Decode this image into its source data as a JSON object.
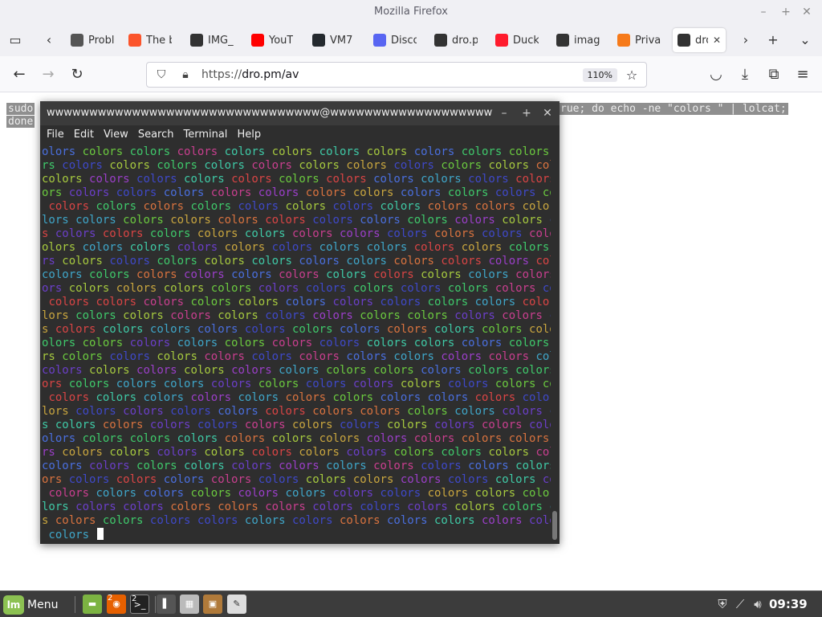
{
  "window": {
    "title": "Mozilla Firefox"
  },
  "tabs": [
    {
      "label": "Probl",
      "icon": "info-icon",
      "color": "#555555"
    },
    {
      "label": "The b",
      "icon": "brave-lion-icon",
      "color": "#fb542b"
    },
    {
      "label": "IMG_",
      "icon": "terminal-favicon",
      "color": "#333333"
    },
    {
      "label": "YouT",
      "icon": "youtube-icon",
      "color": "#ff0000"
    },
    {
      "label": "VM7",
      "icon": "github-icon",
      "color": "#24292e"
    },
    {
      "label": "Disco",
      "icon": "discord-icon",
      "color": "#5865f2"
    },
    {
      "label": "dro.p",
      "icon": "terminal-favicon",
      "color": "#333333"
    },
    {
      "label": "Duck",
      "icon": "opera-icon",
      "color": "#ff1b2d"
    },
    {
      "label": "imag",
      "icon": "terminal-favicon",
      "color": "#333333"
    },
    {
      "label": "Priva",
      "icon": "privacy-icon",
      "color": "#f67a1a"
    },
    {
      "label": "dro",
      "icon": "terminal-favicon",
      "color": "#333333",
      "active": true
    }
  ],
  "navbar": {
    "url_scheme": "https://",
    "url_rest": "dro.pm/av",
    "zoom": "110%"
  },
  "page": {
    "cmd_line1": "sudo",
    "cmd_line1_right": "rue; do echo -ne \"colors \" | lolcat;",
    "cmd_line2": "done"
  },
  "terminal": {
    "title": "wwwwwwwwwwwwwwwwwwwwwwwwwwwwwwww@wwwwwwwwwwwwwwwwwwwwwwwwwwwwwww...",
    "menu": [
      "File",
      "Edit",
      "View",
      "Search",
      "Terminal",
      "Help"
    ],
    "word": "colors",
    "prompt_text": " colors ",
    "line_count": 28,
    "cols": 80,
    "palette": [
      "#4a6fde",
      "#3f49c9",
      "#6b3fc9",
      "#9b3fc9",
      "#c93f8f",
      "#d94545",
      "#d9733f",
      "#c9a63f",
      "#a6c93f",
      "#6bc93f",
      "#3fc96b",
      "#3fc9a6",
      "#3fa6c9"
    ]
  },
  "taskbar": {
    "menu_label": "Menu",
    "clock": "09:39",
    "badge_firefox": "2",
    "badge_terminal": "2"
  }
}
